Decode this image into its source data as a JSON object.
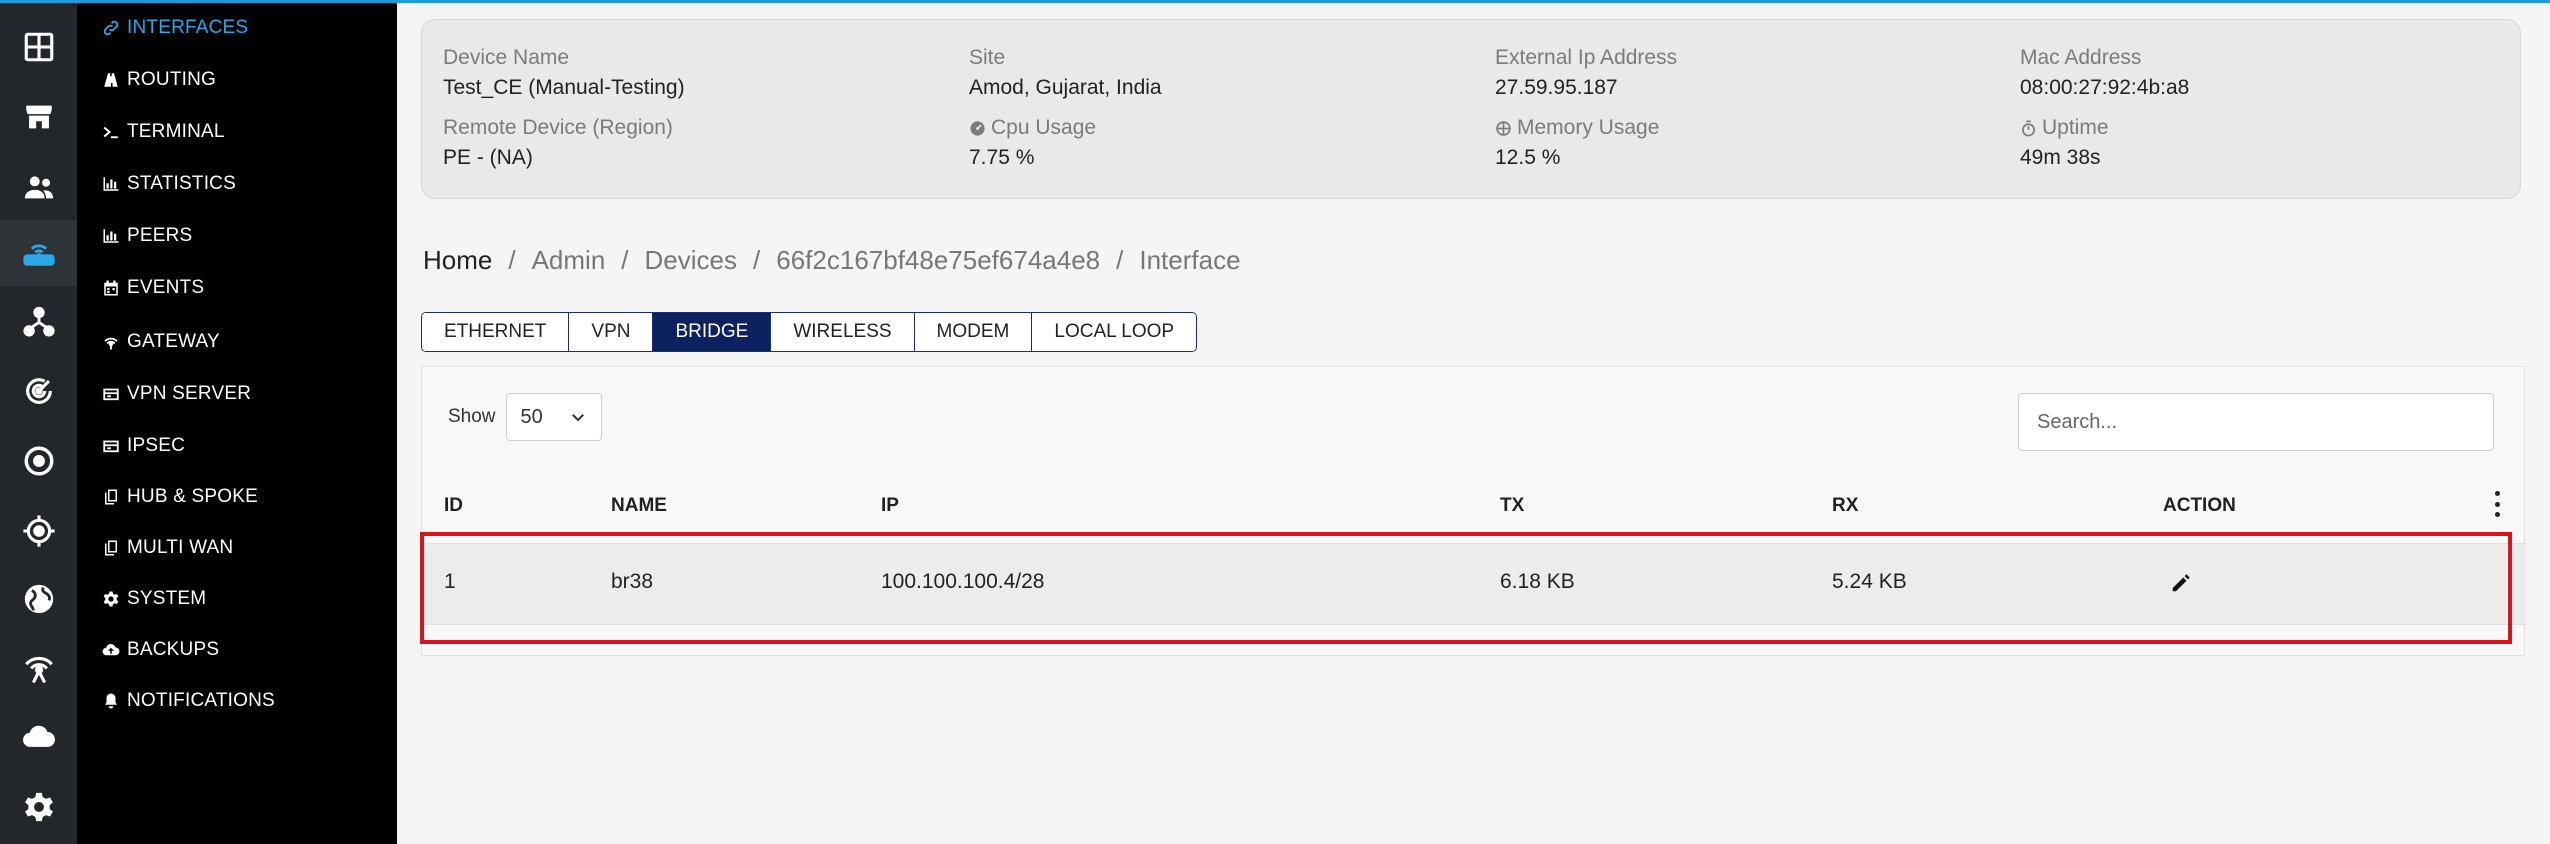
{
  "rail": [
    {
      "icon": "dashboard-grid-icon"
    },
    {
      "icon": "store-icon"
    },
    {
      "icon": "users-icon"
    },
    {
      "icon": "router-icon",
      "active": true
    },
    {
      "icon": "network-topology-icon"
    },
    {
      "icon": "radar-icon"
    },
    {
      "icon": "target-circle-icon"
    },
    {
      "icon": "crosshair-icon"
    },
    {
      "icon": "globe-icon"
    },
    {
      "icon": "wireless-tower-icon"
    },
    {
      "icon": "cloud-icon"
    },
    {
      "icon": "settings-gear-icon"
    }
  ],
  "menu": {
    "interfaces": "INTERFACES",
    "routing": "ROUTING",
    "terminal": "TERMINAL",
    "statistics": "STATISTICS",
    "peers": "PEERS",
    "events": "EVENTS",
    "gateway": "GATEWAY",
    "vpn_server": "VPN SERVER",
    "ipsec": "IPSEC",
    "hub_spoke": "HUB & SPOKE",
    "multi_wan": "MULTI WAN",
    "system": "SYSTEM",
    "backups": "BACKUPS",
    "notifications": "NOTIFICATIONS",
    "active_color": "#2aa7e8"
  },
  "device": {
    "device_name_label": "Device Name",
    "device_name": "Test_CE (Manual-Testing)",
    "site_label": "Site",
    "site": "Amod, Gujarat, India",
    "external_ip_label": "External Ip Address",
    "external_ip": "27.59.95.187",
    "mac_label": "Mac Address",
    "mac": "08:00:27:92:4b:a8",
    "remote_label": "Remote Device (Region)",
    "remote": "PE - (NA)",
    "cpu_label": "Cpu Usage",
    "cpu": "7.75 %",
    "memory_label": "Memory Usage",
    "memory": "12.5 %",
    "uptime_label": "Uptime",
    "uptime": "49m 38s"
  },
  "breadcrumb": {
    "home": "Home",
    "admin": "Admin",
    "devices": "Devices",
    "device_id": "66f2c167bf48e75ef674a4e8",
    "current": "Interface",
    "separator": "/"
  },
  "tabs": {
    "ethernet": "ETHERNET",
    "vpn": "VPN",
    "bridge": "BRIDGE",
    "wireless": "WIRELESS",
    "modem": "MODEM",
    "local_loop": "LOCAL LOOP",
    "active": "BRIDGE",
    "active_color": "#0d2160"
  },
  "table": {
    "show_label": "Show",
    "page_size": "50",
    "search_placeholder": "Search...",
    "columns": {
      "id": "ID",
      "name": "NAME",
      "ip": "IP",
      "tx": "TX",
      "rx": "RX",
      "action": "ACTION"
    },
    "rows": [
      {
        "id": "1",
        "name": "br38",
        "ip": "100.100.100.4/28",
        "tx": "6.18 KB",
        "rx": "5.24 KB"
      }
    ],
    "highlight_color": "#d9141e"
  }
}
